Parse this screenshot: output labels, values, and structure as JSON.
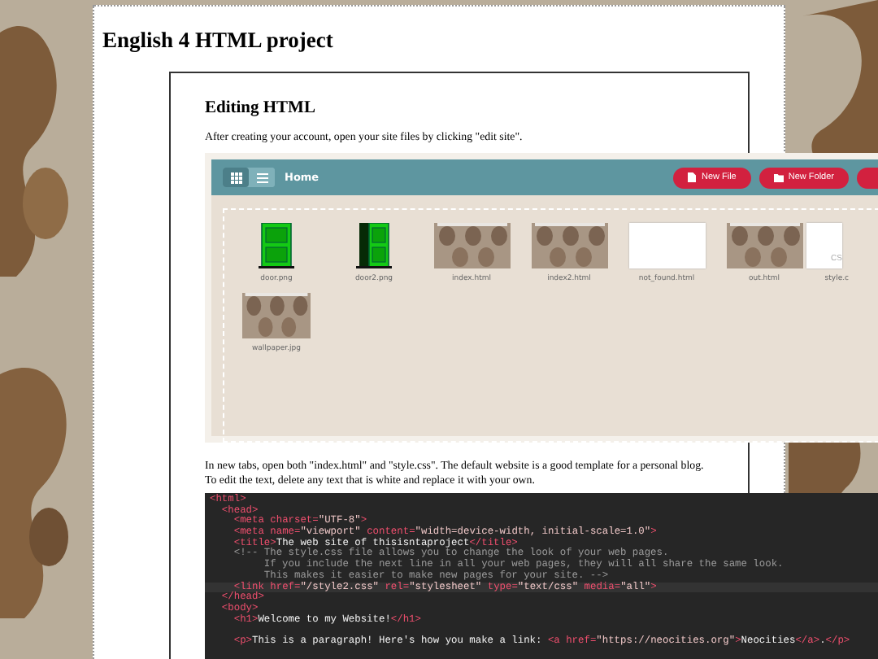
{
  "page_title": "English 4 HTML project",
  "section": {
    "heading": "Editing HTML",
    "intro": "After creating your account, open your site files by clicking \"edit site\".",
    "file_manager": {
      "views": [
        {
          "kind": "grid",
          "selected": true
        },
        {
          "kind": "list",
          "selected": false
        }
      ],
      "title": "Home",
      "buttons": [
        {
          "kind": "file",
          "label": "New File"
        },
        {
          "kind": "folder",
          "label": "New Folder"
        }
      ],
      "files": [
        {
          "kind": "door",
          "name": "door.png"
        },
        {
          "kind": "door-open",
          "name": "door2.png"
        },
        {
          "kind": "picture",
          "name": "index.html"
        },
        {
          "kind": "picture",
          "name": "index2.html"
        },
        {
          "kind": "page",
          "name": "not_found.html"
        },
        {
          "kind": "picture",
          "name": "out.html"
        },
        {
          "kind": "css",
          "name": "style.c",
          "badge": "CS"
        },
        {
          "kind": "picture",
          "name": "wallpaper.jpg"
        }
      ]
    },
    "instructions": "In new tabs, open both \"index.html\" and \"style.css\". The default website is a good template for a personal blog. To edit the text, delete any text that is white and replace it with your own.",
    "code": [
      {
        "highlighted": false,
        "parts": [
          {
            "kind": "tag",
            "t": "<html>"
          }
        ]
      },
      {
        "highlighted": false,
        "parts": [
          {
            "kind": "tag",
            "t": "  <head>"
          }
        ]
      },
      {
        "highlighted": false,
        "parts": [
          {
            "kind": "tag",
            "t": "    <meta "
          },
          {
            "kind": "attr",
            "t": "charset="
          },
          {
            "kind": "str",
            "t": "\"UTF-8\""
          },
          {
            "kind": "tag",
            "t": ">"
          }
        ]
      },
      {
        "highlighted": false,
        "parts": [
          {
            "kind": "tag",
            "t": "    <meta "
          },
          {
            "kind": "attr",
            "t": "name="
          },
          {
            "kind": "str",
            "t": "\"viewport\""
          },
          {
            "kind": "attr",
            "t": " content="
          },
          {
            "kind": "str",
            "t": "\"width=device-width, initial-scale=1.0\""
          },
          {
            "kind": "tag",
            "t": ">"
          }
        ]
      },
      {
        "highlighted": false,
        "parts": [
          {
            "kind": "tag",
            "t": "    <title>"
          },
          {
            "kind": "text",
            "t": "The web site of thisisntaproject"
          },
          {
            "kind": "tag",
            "t": "</title>"
          }
        ]
      },
      {
        "highlighted": false,
        "parts": [
          {
            "kind": "comment",
            "t": "    <!-- The style.css file allows you to change the look of your web pages."
          }
        ]
      },
      {
        "highlighted": false,
        "parts": [
          {
            "kind": "comment",
            "t": "         If you include the next line in all your web pages, they will all share the same look."
          }
        ]
      },
      {
        "highlighted": false,
        "parts": [
          {
            "kind": "comment",
            "t": "         This makes it easier to make new pages for your site. -->"
          }
        ]
      },
      {
        "highlighted": true,
        "parts": [
          {
            "kind": "tag",
            "t": "    <link "
          },
          {
            "kind": "attr",
            "t": "href="
          },
          {
            "kind": "str",
            "t": "\"/style2.css\""
          },
          {
            "kind": "attr",
            "t": " rel="
          },
          {
            "kind": "str",
            "t": "\"stylesheet\""
          },
          {
            "kind": "attr",
            "t": " type="
          },
          {
            "kind": "str",
            "t": "\"text/css\""
          },
          {
            "kind": "attr",
            "t": " media="
          },
          {
            "kind": "str",
            "t": "\"all\""
          },
          {
            "kind": "tag",
            "t": ">"
          }
        ]
      },
      {
        "highlighted": false,
        "parts": [
          {
            "kind": "tag",
            "t": "  </head>"
          }
        ]
      },
      {
        "highlighted": false,
        "parts": [
          {
            "kind": "tag",
            "t": "  <body>"
          }
        ]
      },
      {
        "highlighted": false,
        "gap_after": true,
        "parts": [
          {
            "kind": "tag",
            "t": "    <h1>"
          },
          {
            "kind": "text",
            "t": "Welcome to my Website!"
          },
          {
            "kind": "tag",
            "t": "</h1>"
          }
        ]
      },
      {
        "highlighted": false,
        "parts": [
          {
            "kind": "tag",
            "t": "    <p>"
          },
          {
            "kind": "text",
            "t": "This is a paragraph! Here's how you make a link: "
          },
          {
            "kind": "tag",
            "t": "<a "
          },
          {
            "kind": "attr",
            "t": "href="
          },
          {
            "kind": "str",
            "t": "\"https://neocities.org\""
          },
          {
            "kind": "tag",
            "t": ">"
          },
          {
            "kind": "text",
            "t": "Neocities"
          },
          {
            "kind": "tag",
            "t": "</a>"
          },
          {
            "kind": "text",
            "t": "."
          },
          {
            "kind": "tag",
            "t": "</p>"
          }
        ]
      }
    ]
  }
}
